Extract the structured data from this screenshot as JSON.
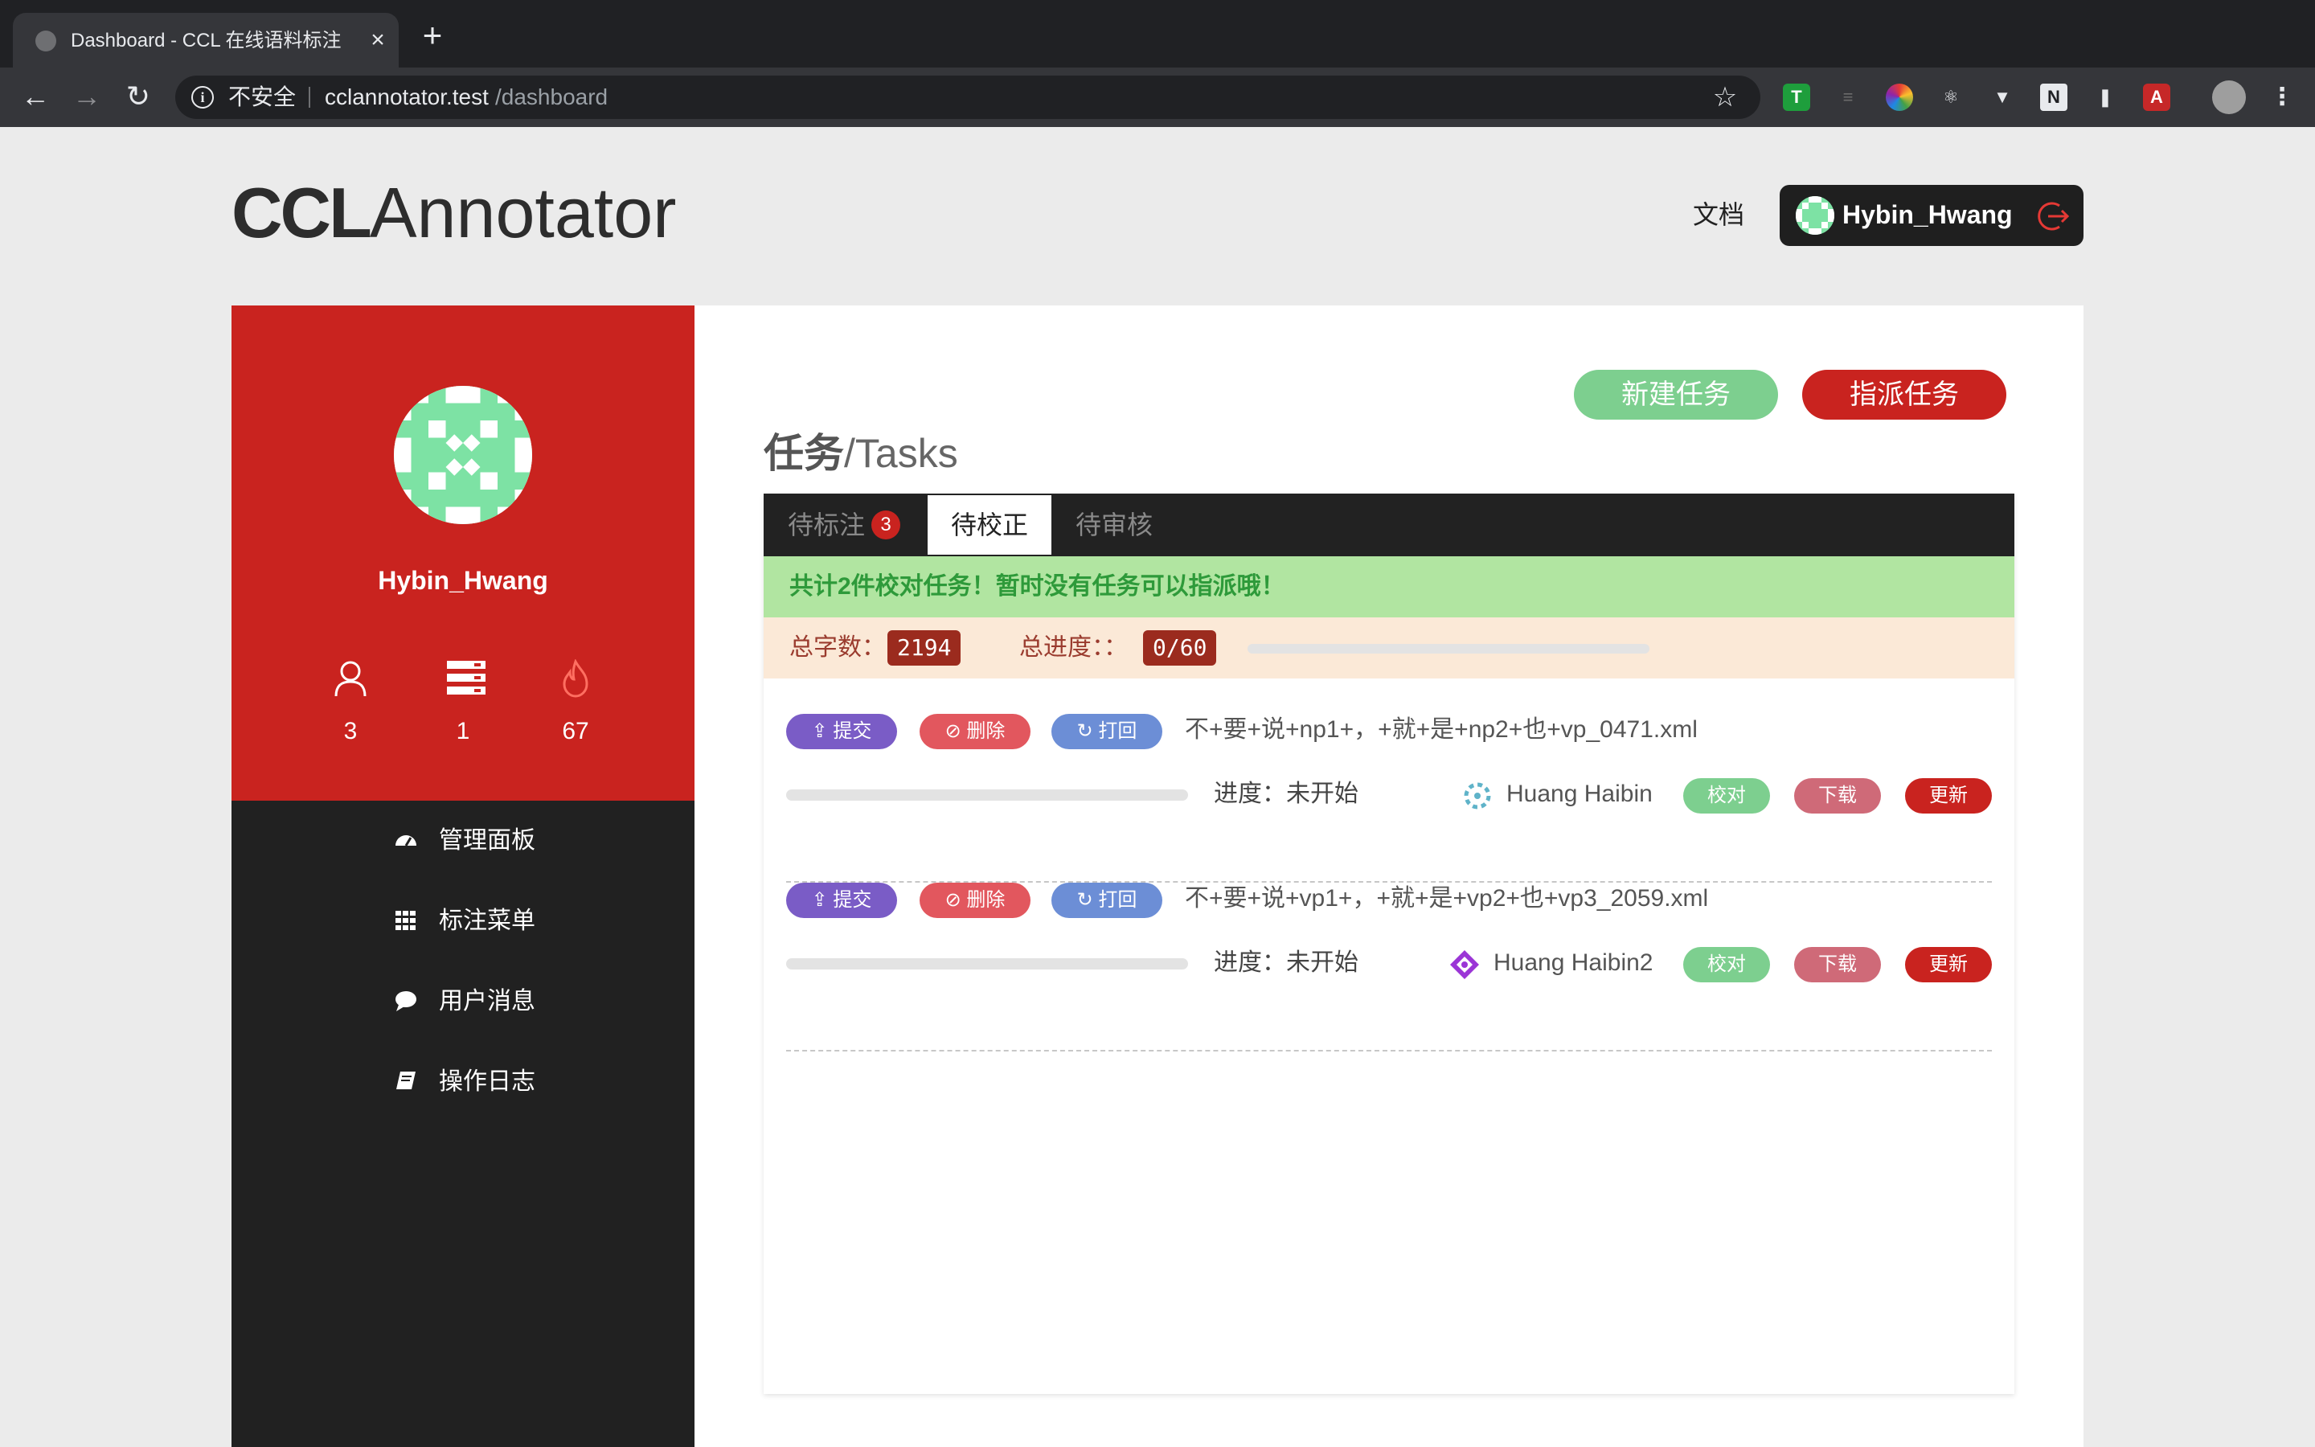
{
  "browser": {
    "tab_title": "Dashboard - CCL 在线语料标注",
    "tab_close": "×",
    "new_tab": "+",
    "insecure_label": "不安全",
    "url_host": "cclannotator.test",
    "url_path": "/dashboard"
  },
  "header": {
    "logo_bold": "CCL",
    "logo_light": "Annotator",
    "docs_link": "文档",
    "username": "Hybin_Hwang"
  },
  "profile": {
    "username": "Hybin_Hwang",
    "stats": [
      {
        "icon": "user-icon",
        "value": "3"
      },
      {
        "icon": "server-icon",
        "value": "1"
      },
      {
        "icon": "fire-icon",
        "value": "67"
      }
    ]
  },
  "sidebar": {
    "items": [
      {
        "icon": "dashboard-icon",
        "label": "管理面板"
      },
      {
        "icon": "grid-icon",
        "label": "标注菜单"
      },
      {
        "icon": "comment-icon",
        "label": "用户消息"
      },
      {
        "icon": "book-icon",
        "label": "操作日志"
      }
    ]
  },
  "main": {
    "new_task_button": "新建任务",
    "assign_task_button": "指派任务",
    "title_cn": "任务",
    "title_en": "/Tasks",
    "tabs": [
      {
        "label": "待标注",
        "badge": "3"
      },
      {
        "label": "待校正"
      },
      {
        "label": "待审核"
      }
    ],
    "alert": "共计2件校对任务！暂时没有任务可以指派哦！",
    "total_chars_label": "总字数：",
    "total_chars": "2194",
    "total_progress_label": "总进度：：",
    "total_progress": "0/60",
    "total_progress_fraction": 0,
    "tasks": [
      {
        "submit": "提交",
        "delete": "删除",
        "reject": "打回",
        "filename": "不+要+说+np1+，+就+是+np2+也+vp_0471.xml",
        "progress_label": "进度：未开始",
        "progress_fraction": 0,
        "person": "Huang Haibin",
        "check": "校对",
        "download": "下载",
        "update": "更新",
        "avatar_color": "#5fb3c9"
      },
      {
        "submit": "提交",
        "delete": "删除",
        "reject": "打回",
        "filename": "不+要+说+vp1+，+就+是+vp2+也+vp3_2059.xml",
        "progress_label": "进度：未开始",
        "progress_fraction": 0,
        "person": "Huang Haibin2",
        "check": "校对",
        "download": "下载",
        "update": "更新",
        "avatar_color": "#9b35d6"
      }
    ]
  },
  "colors": {
    "brand_red": "#c9231f",
    "dark": "#212121",
    "green_button": "#7dcf8f",
    "purple_button": "#7a5cc6",
    "pink_button": "#e2575e",
    "blue_button": "#6c8ed6",
    "download_button": "#cf6a78"
  }
}
